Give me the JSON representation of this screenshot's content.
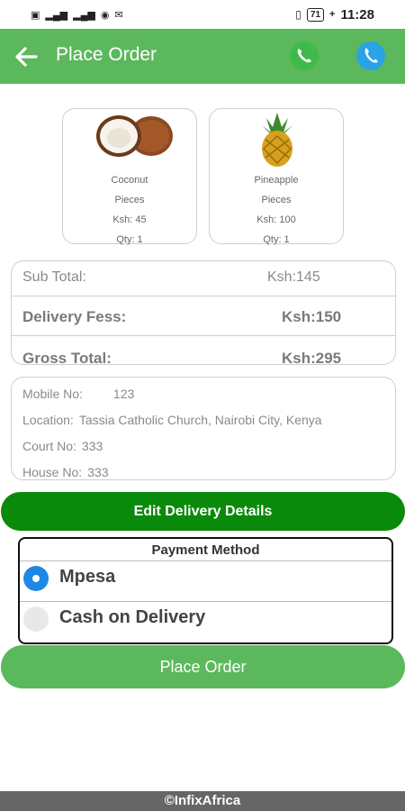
{
  "status_bar": {
    "left_icons": [
      "sim-icon",
      "signal-icon",
      "signal-icon",
      "hotspot-icon",
      "mail-icon"
    ],
    "battery": "71",
    "time": "11:28"
  },
  "header": {
    "title": "Place Order",
    "back_icon": "arrow-left-icon",
    "call_icon_1": "phone-icon",
    "call_icon_2": "phone-icon",
    "color": "#5cb85c"
  },
  "products": [
    {
      "name": "Coconut",
      "unit": "Pieces",
      "price": "Ksh: 45",
      "qty": "Qty: 1"
    },
    {
      "name": "Pineapple",
      "unit": "Pieces",
      "price": "Ksh: 100",
      "qty": "Qty: 1"
    }
  ],
  "totals": {
    "sub_total_label": "Sub Total:",
    "sub_total_value": "Ksh:145",
    "delivery_label": "Delivery Fess:",
    "delivery_value": "Ksh:150",
    "gross_label": "Gross Total:",
    "gross_value": "Ksh:295"
  },
  "delivery": {
    "mobile_label": "Mobile No:",
    "mobile_value": "123",
    "location_label": "Location:",
    "location_value": "Tassia Catholic Church, Nairobi City, Kenya",
    "court_label": "Court No:",
    "court_value": "333",
    "house_label": "House No:",
    "house_value": "333"
  },
  "edit_button": "Edit Delivery Details",
  "payment": {
    "title": "Payment Method",
    "options": [
      {
        "label": "Mpesa",
        "selected": true
      },
      {
        "label": "Cash on Delivery",
        "selected": false
      }
    ]
  },
  "place_order_button": "Place Order",
  "footer": "©InfixAfrica",
  "colors": {
    "accent": "#5cb85c",
    "edit_button": "#0a8a0a",
    "radio_selected": "#1e88e5"
  }
}
